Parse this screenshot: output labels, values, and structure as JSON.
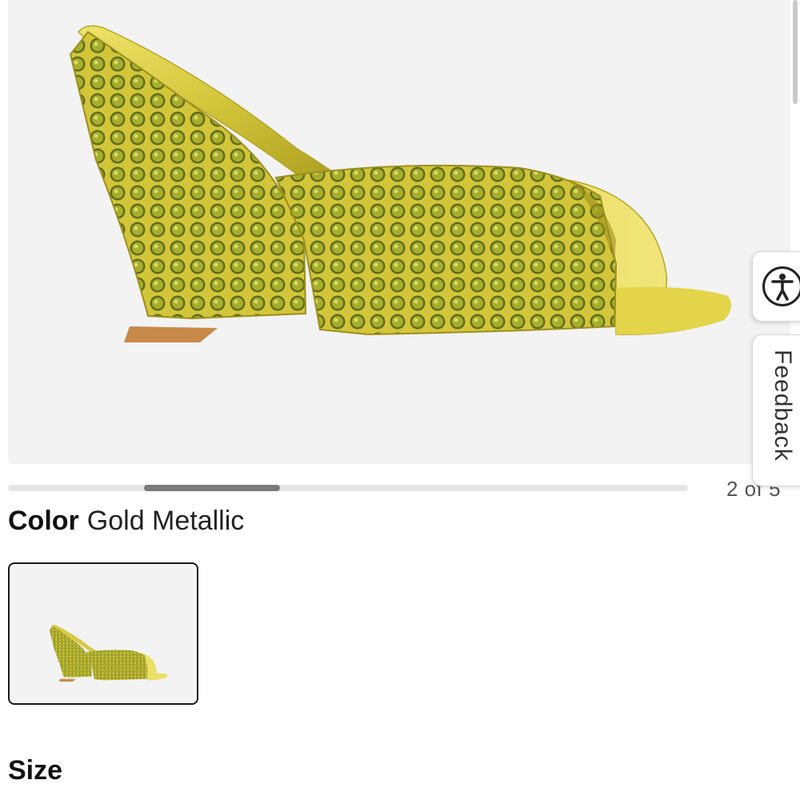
{
  "gallery": {
    "counter": "2 of 5",
    "current_index": 2,
    "total": 5,
    "scroll_position": 0.2
  },
  "product": {
    "color_label": "Color",
    "color_value": "Gold Metallic",
    "swatch_icon": "shoe-thumbnail-gold-metallic",
    "size_label": "Size"
  },
  "widgets": {
    "accessibility_icon": "accessibility-icon",
    "feedback_label": "Feedback"
  },
  "colors": {
    "shoe_gold": "#d4c63a",
    "gem_green": "#7a8a22",
    "heel_tan": "#c8894a",
    "thumb": "#7a7a7a"
  }
}
